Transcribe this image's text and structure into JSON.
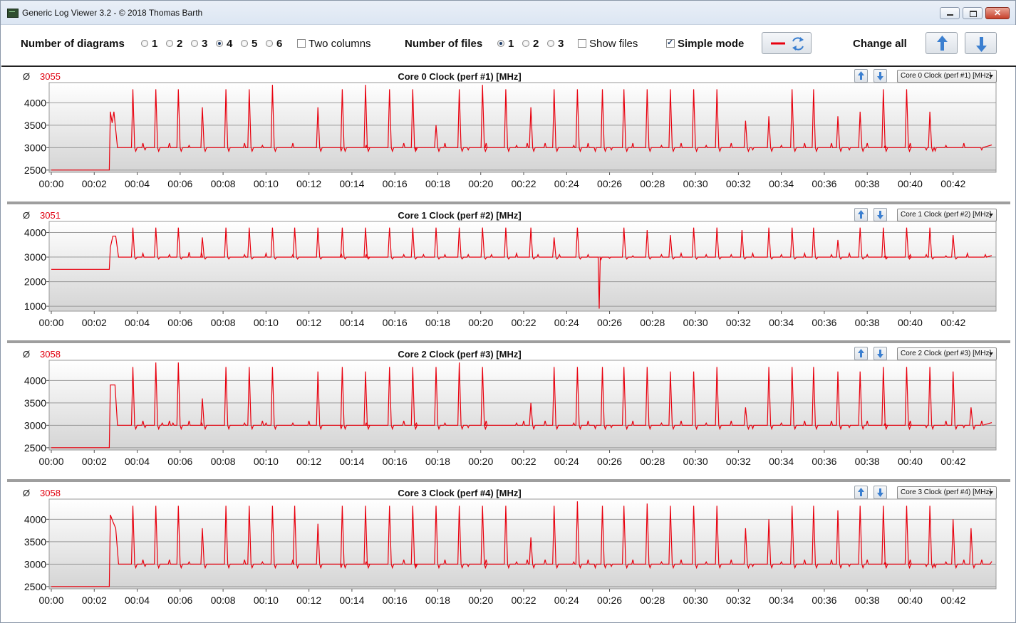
{
  "window": {
    "title": "Generic Log Viewer 3.2 - © 2018 Thomas Barth",
    "close_glyph": "✕"
  },
  "toolbar": {
    "num_diagrams_label": "Number of diagrams",
    "diagram_options": [
      "1",
      "2",
      "3",
      "4",
      "5",
      "6"
    ],
    "diagram_selected": "4",
    "two_columns_label": "Two columns",
    "two_columns_checked": false,
    "num_files_label": "Number of files",
    "file_options": [
      "1",
      "2",
      "3"
    ],
    "file_selected": "1",
    "show_files_label": "Show files",
    "show_files_checked": false,
    "simple_mode_label": "Simple mode",
    "simple_mode_checked": true,
    "change_all_label": "Change all",
    "icons": [
      "red-line-icon",
      "refresh-icon",
      "arrow-up-icon",
      "arrow-down-icon"
    ]
  },
  "colors": {
    "line": "#e8000e",
    "accent": "#3b7fd0",
    "average": "#e0000f"
  },
  "avg_symbol": "Ø",
  "x_ticks": [
    "00:00",
    "00:02",
    "00:04",
    "00:06",
    "00:08",
    "00:10",
    "00:12",
    "00:14",
    "00:16",
    "00:18",
    "00:20",
    "00:22",
    "00:24",
    "00:26",
    "00:28",
    "00:30",
    "00:32",
    "00:34",
    "00:36",
    "00:38",
    "00:40",
    "00:42"
  ],
  "chart_data": [
    {
      "type": "line",
      "title": "Core 0 Clock (perf #1) [MHz]",
      "selector": "Core 0 Clock (perf #1) [MHz]",
      "average": "3055",
      "y_ticks": [
        2500,
        3000,
        3500,
        4000
      ],
      "ylim": [
        2450,
        4450
      ],
      "xlim_seconds": [
        0,
        2630
      ],
      "baseline_start": 2500,
      "baseline_end_s": 162,
      "base": 3000,
      "ramp": [
        [
          165,
          3800
        ],
        [
          170,
          3550
        ],
        [
          175,
          3800
        ],
        [
          185,
          3000
        ]
      ],
      "spikes": [
        [
          228,
          4300
        ],
        [
          292,
          4300
        ],
        [
          355,
          4300
        ],
        [
          422,
          3900
        ],
        [
          488,
          4300
        ],
        [
          553,
          4300
        ],
        [
          618,
          4400
        ],
        [
          745,
          3900
        ],
        [
          813,
          4300
        ],
        [
          878,
          4400
        ],
        [
          945,
          4300
        ],
        [
          1010,
          4300
        ],
        [
          1075,
          3500
        ],
        [
          1140,
          4300
        ],
        [
          1205,
          4400
        ],
        [
          1270,
          4300
        ],
        [
          1340,
          3900
        ],
        [
          1405,
          4300
        ],
        [
          1470,
          4300
        ],
        [
          1540,
          4300
        ],
        [
          1600,
          4300
        ],
        [
          1665,
          4300
        ],
        [
          1730,
          4300
        ],
        [
          1795,
          4300
        ],
        [
          1860,
          4300
        ],
        [
          1940,
          3600
        ],
        [
          2005,
          3700
        ],
        [
          2070,
          4300
        ],
        [
          2130,
          4300
        ],
        [
          2198,
          3700
        ],
        [
          2260,
          3800
        ],
        [
          2325,
          4300
        ],
        [
          2390,
          4300
        ],
        [
          2455,
          3800
        ]
      ],
      "blips": [
        [
          256,
          3100
        ],
        [
          262,
          2950
        ],
        [
          330,
          3100
        ],
        [
          385,
          3050
        ],
        [
          540,
          3100
        ],
        [
          590,
          3050
        ],
        [
          675,
          3100
        ],
        [
          810,
          2930
        ],
        [
          880,
          3050
        ],
        [
          985,
          3100
        ],
        [
          1020,
          2950
        ],
        [
          1100,
          3100
        ],
        [
          1165,
          2950
        ],
        [
          1215,
          3100
        ],
        [
          1300,
          3050
        ],
        [
          1330,
          3100
        ],
        [
          1380,
          3100
        ],
        [
          1460,
          3050
        ],
        [
          1500,
          3100
        ],
        [
          1520,
          2920
        ],
        [
          1565,
          2950
        ],
        [
          1625,
          3100
        ],
        [
          1705,
          3050
        ],
        [
          1760,
          3100
        ],
        [
          1830,
          3050
        ],
        [
          1900,
          3100
        ],
        [
          1960,
          2950
        ],
        [
          2040,
          3050
        ],
        [
          2105,
          3100
        ],
        [
          2180,
          3100
        ],
        [
          2230,
          2950
        ],
        [
          2280,
          3100
        ],
        [
          2330,
          3050
        ],
        [
          2400,
          3100
        ],
        [
          2445,
          2950
        ],
        [
          2470,
          2930
        ],
        [
          2500,
          3050
        ],
        [
          2550,
          3100
        ],
        [
          2600,
          2950
        ]
      ]
    },
    {
      "type": "line",
      "title": "Core 1 Clock (perf #2) [MHz]",
      "selector": "Core 1 Clock (perf #2) [MHz]",
      "average": "3051",
      "y_ticks": [
        1000,
        2000,
        3000,
        4000
      ],
      "ylim": [
        800,
        4450
      ],
      "xlim_seconds": [
        0,
        2630
      ],
      "baseline_start": 2500,
      "baseline_end_s": 162,
      "base": 3000,
      "ramp": [
        [
          165,
          3400
        ],
        [
          172,
          3850
        ],
        [
          180,
          3850
        ],
        [
          188,
          3000
        ]
      ],
      "spikes": [
        [
          228,
          4200
        ],
        [
          292,
          4200
        ],
        [
          355,
          4200
        ],
        [
          422,
          3800
        ],
        [
          488,
          4200
        ],
        [
          553,
          4200
        ],
        [
          618,
          4200
        ],
        [
          680,
          4200
        ],
        [
          745,
          4200
        ],
        [
          813,
          4200
        ],
        [
          878,
          4200
        ],
        [
          945,
          4200
        ],
        [
          1010,
          4200
        ],
        [
          1075,
          4200
        ],
        [
          1140,
          4200
        ],
        [
          1205,
          4200
        ],
        [
          1270,
          4200
        ],
        [
          1340,
          4200
        ],
        [
          1405,
          3800
        ],
        [
          1470,
          4200
        ],
        [
          1600,
          4200
        ],
        [
          1665,
          4100
        ],
        [
          1730,
          3900
        ],
        [
          1795,
          4200
        ],
        [
          1860,
          4200
        ],
        [
          1930,
          4100
        ],
        [
          2005,
          4200
        ],
        [
          2070,
          4200
        ],
        [
          2130,
          4200
        ],
        [
          2198,
          3700
        ],
        [
          2260,
          4200
        ],
        [
          2325,
          4200
        ],
        [
          2390,
          4200
        ],
        [
          2455,
          4200
        ],
        [
          2520,
          3900
        ]
      ],
      "blips": [
        [
          256,
          3150
        ],
        [
          330,
          3100
        ],
        [
          385,
          3200
        ],
        [
          420,
          3150
        ],
        [
          540,
          3100
        ],
        [
          600,
          3150
        ],
        [
          675,
          3100
        ],
        [
          810,
          3150
        ],
        [
          880,
          3100
        ],
        [
          985,
          3100
        ],
        [
          1040,
          3100
        ],
        [
          1100,
          3100
        ],
        [
          1165,
          3100
        ],
        [
          1230,
          3100
        ],
        [
          1300,
          3150
        ],
        [
          1360,
          3100
        ],
        [
          1420,
          3100
        ],
        [
          1500,
          3100
        ],
        [
          1527,
          3000
        ],
        [
          1531,
          900
        ],
        [
          1536,
          2900
        ],
        [
          1545,
          3000
        ],
        [
          1560,
          2950
        ],
        [
          1625,
          3050
        ],
        [
          1705,
          3100
        ],
        [
          1760,
          3150
        ],
        [
          1830,
          3100
        ],
        [
          1900,
          3100
        ],
        [
          1960,
          3150
        ],
        [
          2040,
          3100
        ],
        [
          2105,
          3150
        ],
        [
          2180,
          3100
        ],
        [
          2230,
          3150
        ],
        [
          2280,
          3100
        ],
        [
          2330,
          3050
        ],
        [
          2400,
          3100
        ],
        [
          2445,
          3100
        ],
        [
          2500,
          3050
        ],
        [
          2560,
          3150
        ],
        [
          2610,
          3100
        ]
      ]
    },
    {
      "type": "line",
      "title": "Core 2 Clock (perf #3) [MHz]",
      "selector": "Core 2 Clock (perf #3) [MHz]",
      "average": "3058",
      "y_ticks": [
        2500,
        3000,
        3500,
        4000
      ],
      "ylim": [
        2450,
        4450
      ],
      "xlim_seconds": [
        0,
        2630
      ],
      "baseline_start": 2500,
      "baseline_end_s": 162,
      "base": 3000,
      "ramp": [
        [
          165,
          3900
        ],
        [
          178,
          3900
        ],
        [
          185,
          3000
        ]
      ],
      "spikes": [
        [
          228,
          4300
        ],
        [
          292,
          4400
        ],
        [
          355,
          4400
        ],
        [
          422,
          3600
        ],
        [
          488,
          4300
        ],
        [
          553,
          4300
        ],
        [
          618,
          4300
        ],
        [
          745,
          4200
        ],
        [
          813,
          4300
        ],
        [
          878,
          4200
        ],
        [
          945,
          4300
        ],
        [
          1010,
          4300
        ],
        [
          1075,
          4300
        ],
        [
          1140,
          4400
        ],
        [
          1205,
          4300
        ],
        [
          1340,
          3500
        ],
        [
          1405,
          4300
        ],
        [
          1470,
          4300
        ],
        [
          1540,
          4300
        ],
        [
          1600,
          4300
        ],
        [
          1665,
          4300
        ],
        [
          1730,
          4200
        ],
        [
          1795,
          4200
        ],
        [
          1860,
          4300
        ],
        [
          1940,
          3400
        ],
        [
          2005,
          4300
        ],
        [
          2070,
          4300
        ],
        [
          2130,
          4300
        ],
        [
          2198,
          4200
        ],
        [
          2260,
          4200
        ],
        [
          2325,
          4300
        ],
        [
          2390,
          4300
        ],
        [
          2455,
          4300
        ],
        [
          2520,
          4200
        ],
        [
          2570,
          3400
        ]
      ],
      "blips": [
        [
          256,
          3100
        ],
        [
          262,
          2950
        ],
        [
          310,
          3050
        ],
        [
          330,
          3100
        ],
        [
          340,
          3050
        ],
        [
          385,
          3100
        ],
        [
          420,
          3050
        ],
        [
          540,
          3050
        ],
        [
          590,
          3100
        ],
        [
          600,
          3050
        ],
        [
          675,
          3050
        ],
        [
          720,
          3100
        ],
        [
          810,
          2930
        ],
        [
          880,
          3050
        ],
        [
          985,
          3100
        ],
        [
          1020,
          3050
        ],
        [
          1100,
          3050
        ],
        [
          1165,
          2950
        ],
        [
          1215,
          3100
        ],
        [
          1300,
          3050
        ],
        [
          1320,
          3100
        ],
        [
          1380,
          3100
        ],
        [
          1460,
          3050
        ],
        [
          1500,
          3100
        ],
        [
          1520,
          2930
        ],
        [
          1565,
          2950
        ],
        [
          1625,
          3100
        ],
        [
          1705,
          3050
        ],
        [
          1760,
          3100
        ],
        [
          1830,
          3050
        ],
        [
          1900,
          3100
        ],
        [
          1960,
          2930
        ],
        [
          2040,
          3050
        ],
        [
          2105,
          3100
        ],
        [
          2180,
          3100
        ],
        [
          2230,
          2950
        ],
        [
          2280,
          3100
        ],
        [
          2330,
          3050
        ],
        [
          2400,
          3100
        ],
        [
          2445,
          2950
        ],
        [
          2500,
          3100
        ],
        [
          2550,
          2950
        ],
        [
          2600,
          3100
        ]
      ]
    },
    {
      "type": "line",
      "title": "Core 3 Clock (perf #4) [MHz]",
      "selector": "Core 3 Clock (perf #4) [MHz]",
      "average": "3058",
      "y_ticks": [
        2500,
        3000,
        3500,
        4000
      ],
      "ylim": [
        2450,
        4450
      ],
      "xlim_seconds": [
        0,
        2630
      ],
      "baseline_start": 2500,
      "baseline_end_s": 162,
      "base": 3000,
      "ramp": [
        [
          165,
          4100
        ],
        [
          172,
          3950
        ],
        [
          180,
          3800
        ],
        [
          188,
          3000
        ]
      ],
      "spikes": [
        [
          228,
          4300
        ],
        [
          292,
          4300
        ],
        [
          355,
          4300
        ],
        [
          422,
          3800
        ],
        [
          488,
          4300
        ],
        [
          553,
          4300
        ],
        [
          618,
          4300
        ],
        [
          680,
          4300
        ],
        [
          745,
          3900
        ],
        [
          813,
          4300
        ],
        [
          878,
          4300
        ],
        [
          945,
          4300
        ],
        [
          1010,
          4300
        ],
        [
          1075,
          4300
        ],
        [
          1140,
          4300
        ],
        [
          1205,
          4300
        ],
        [
          1270,
          4300
        ],
        [
          1340,
          3600
        ],
        [
          1405,
          4300
        ],
        [
          1470,
          4400
        ],
        [
          1540,
          4300
        ],
        [
          1600,
          4300
        ],
        [
          1665,
          4350
        ],
        [
          1730,
          4300
        ],
        [
          1795,
          4300
        ],
        [
          1860,
          4300
        ],
        [
          1940,
          3800
        ],
        [
          2005,
          4000
        ],
        [
          2070,
          4300
        ],
        [
          2130,
          4300
        ],
        [
          2198,
          4200
        ],
        [
          2260,
          4300
        ],
        [
          2325,
          4300
        ],
        [
          2390,
          4300
        ],
        [
          2455,
          4300
        ],
        [
          2520,
          4000
        ],
        [
          2570,
          3800
        ]
      ],
      "blips": [
        [
          256,
          3100
        ],
        [
          262,
          2950
        ],
        [
          330,
          3100
        ],
        [
          385,
          3050
        ],
        [
          540,
          3100
        ],
        [
          590,
          3050
        ],
        [
          675,
          3100
        ],
        [
          810,
          2930
        ],
        [
          880,
          3050
        ],
        [
          985,
          3100
        ],
        [
          1020,
          2950
        ],
        [
          1100,
          3100
        ],
        [
          1165,
          2950
        ],
        [
          1215,
          3100
        ],
        [
          1300,
          3050
        ],
        [
          1330,
          3100
        ],
        [
          1380,
          3100
        ],
        [
          1460,
          3050
        ],
        [
          1500,
          3100
        ],
        [
          1520,
          2920
        ],
        [
          1565,
          2950
        ],
        [
          1625,
          3100
        ],
        [
          1705,
          3050
        ],
        [
          1760,
          3100
        ],
        [
          1830,
          3050
        ],
        [
          1900,
          3100
        ],
        [
          1960,
          2950
        ],
        [
          2040,
          3050
        ],
        [
          2105,
          3100
        ],
        [
          2180,
          3100
        ],
        [
          2230,
          2950
        ],
        [
          2280,
          3100
        ],
        [
          2330,
          3050
        ],
        [
          2400,
          3100
        ],
        [
          2445,
          2950
        ],
        [
          2470,
          2930
        ],
        [
          2500,
          3050
        ],
        [
          2550,
          3100
        ],
        [
          2600,
          3100
        ],
        [
          2620,
          3000
        ]
      ]
    }
  ]
}
